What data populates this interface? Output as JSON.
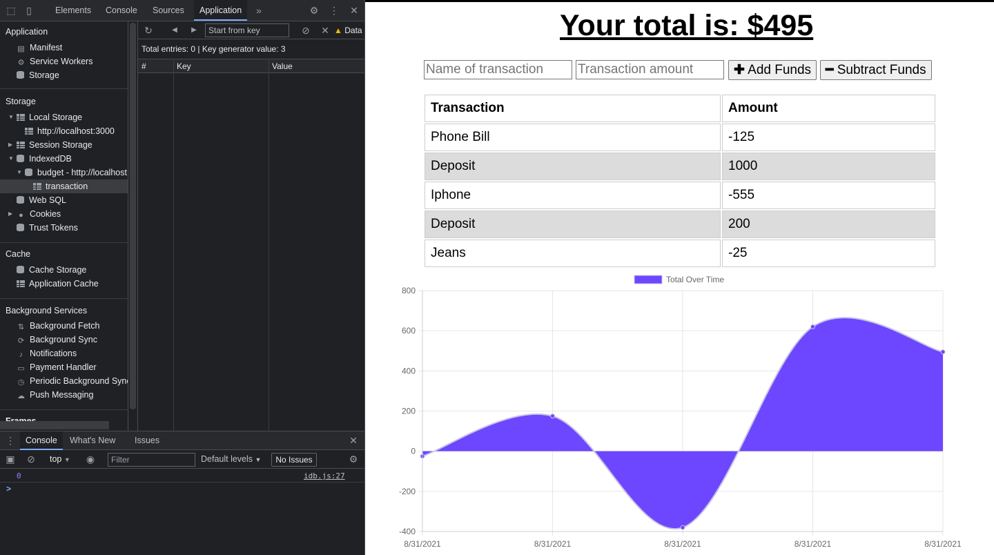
{
  "devtools": {
    "tabs": [
      "Elements",
      "Console",
      "Sources",
      "Application"
    ],
    "active_tab": "Application",
    "sidebar": {
      "sections": {
        "application": "Application",
        "storage": "Storage",
        "cache": "Cache",
        "background_services": "Background Services",
        "frames": "Frames"
      },
      "application_items": [
        "Manifest",
        "Service Workers",
        "Storage"
      ],
      "storage_items": {
        "local_storage": "Local Storage",
        "local_storage_origin": "http://localhost:3000",
        "session_storage": "Session Storage",
        "indexeddb": "IndexedDB",
        "budget_db": "budget - http://localhost",
        "transaction_store": "transaction",
        "web_sql": "Web SQL",
        "cookies": "Cookies",
        "trust_tokens": "Trust Tokens"
      },
      "cache_items": [
        "Cache Storage",
        "Application Cache"
      ],
      "background_items": [
        "Background Fetch",
        "Background Sync",
        "Notifications",
        "Payment Handler",
        "Periodic Background Sync",
        "Push Messaging"
      ]
    },
    "idb_panel": {
      "start_from_key_placeholder": "Start from key",
      "data_warning": "Data",
      "info": "Total entries: 0 | Key generator value: 3",
      "columns": [
        "#",
        "Key",
        "Value"
      ]
    },
    "drawer": {
      "tabs": [
        "Console",
        "What's New",
        "Issues"
      ],
      "context": "top",
      "filter_placeholder": "Filter",
      "levels": "Default levels",
      "issues_button": "No Issues",
      "log_value": "0",
      "log_source": "idb.js:27",
      "prompt": ">"
    }
  },
  "page": {
    "total_text": "Your total is: $495",
    "name_placeholder": "Name of transaction",
    "amount_placeholder": "Transaction amount",
    "add_button": "Add Funds",
    "subtract_button": "Subtract Funds",
    "table": {
      "headers": [
        "Transaction",
        "Amount"
      ],
      "rows": [
        [
          "Phone Bill",
          "-125"
        ],
        [
          "Deposit",
          "1000"
        ],
        [
          "Iphone",
          "-555"
        ],
        [
          "Deposit",
          "200"
        ],
        [
          "Jeans",
          "-25"
        ]
      ]
    }
  },
  "chart_data": {
    "type": "area",
    "x": [
      "8/31/2021",
      "8/31/2021",
      "8/31/2021",
      "8/31/2021",
      "8/31/2021"
    ],
    "series": [
      {
        "name": "Total Over Time",
        "values": [
          -25,
          175,
          -380,
          620,
          495
        ],
        "color": "#6c47ff"
      }
    ],
    "ylim": [
      -400,
      800
    ],
    "yticks": [
      800,
      600,
      400,
      200,
      0,
      -200,
      -400
    ],
    "grid": true,
    "legend": "top"
  }
}
